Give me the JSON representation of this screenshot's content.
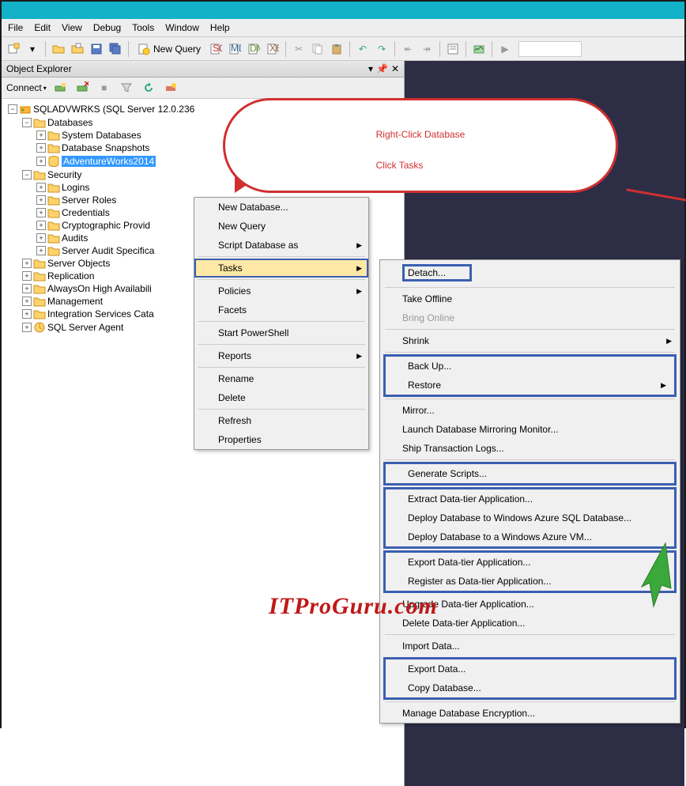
{
  "menubar": {
    "file": "File",
    "edit": "Edit",
    "view": "View",
    "debug": "Debug",
    "tools": "Tools",
    "window": "Window",
    "help": "Help"
  },
  "toolbar": {
    "newquery": "New Query"
  },
  "explorer": {
    "title": "Object Explorer",
    "connect": "Connect",
    "server": "SQLADVWRKS (SQL Server 12.0.236",
    "nodes": {
      "databases": "Databases",
      "sysdb": "System Databases",
      "dbsnap": "Database Snapshots",
      "adv": "AdventureWorks2014",
      "security": "Security",
      "logins": "Logins",
      "serverroles": "Server Roles",
      "credentials": "Credentials",
      "crypto": "Cryptographic Provid",
      "audits": "Audits",
      "saspec": "Server Audit Specifica",
      "serverobj": "Server Objects",
      "replication": "Replication",
      "alwayson": "AlwaysOn High Availabili",
      "management": "Management",
      "iscat": "Integration Services Cata",
      "sqlagent": "SQL Server Agent"
    }
  },
  "ctx": {
    "newdb": "New Database...",
    "newq": "New Query",
    "script": "Script Database as",
    "tasks": "Tasks",
    "policies": "Policies",
    "facets": "Facets",
    "startps": "Start PowerShell",
    "reports": "Reports",
    "rename": "Rename",
    "delete": "Delete",
    "refresh": "Refresh",
    "props": "Properties"
  },
  "sub": {
    "detach": "Detach...",
    "takeoff": "Take Offline",
    "bringon": "Bring Online",
    "shrink": "Shrink",
    "backup": "Back Up...",
    "restore": "Restore",
    "mirror": "Mirror...",
    "launchmm": "Launch Database Mirroring Monitor...",
    "shiptx": "Ship Transaction Logs...",
    "genscr": "Generate Scripts...",
    "extract": "Extract Data-tier Application...",
    "deployaz": "Deploy Database to Windows Azure SQL Database...",
    "deployvm": "Deploy Database to a Windows Azure VM...",
    "exportdta": "Export Data-tier Application...",
    "register": "Register as Data-tier Application...",
    "upgrade": "Upgrade Data-tier Application...",
    "deldta": "Delete Data-tier Application...",
    "importd": "Import Data...",
    "exportd": "Export Data...",
    "copydb": "Copy Database...",
    "manageenc": "Manage Database Encryption..."
  },
  "callout": {
    "line1": "Right-Click Database",
    "line2": "Click Tasks"
  },
  "watermark": "ITProGuru.com"
}
